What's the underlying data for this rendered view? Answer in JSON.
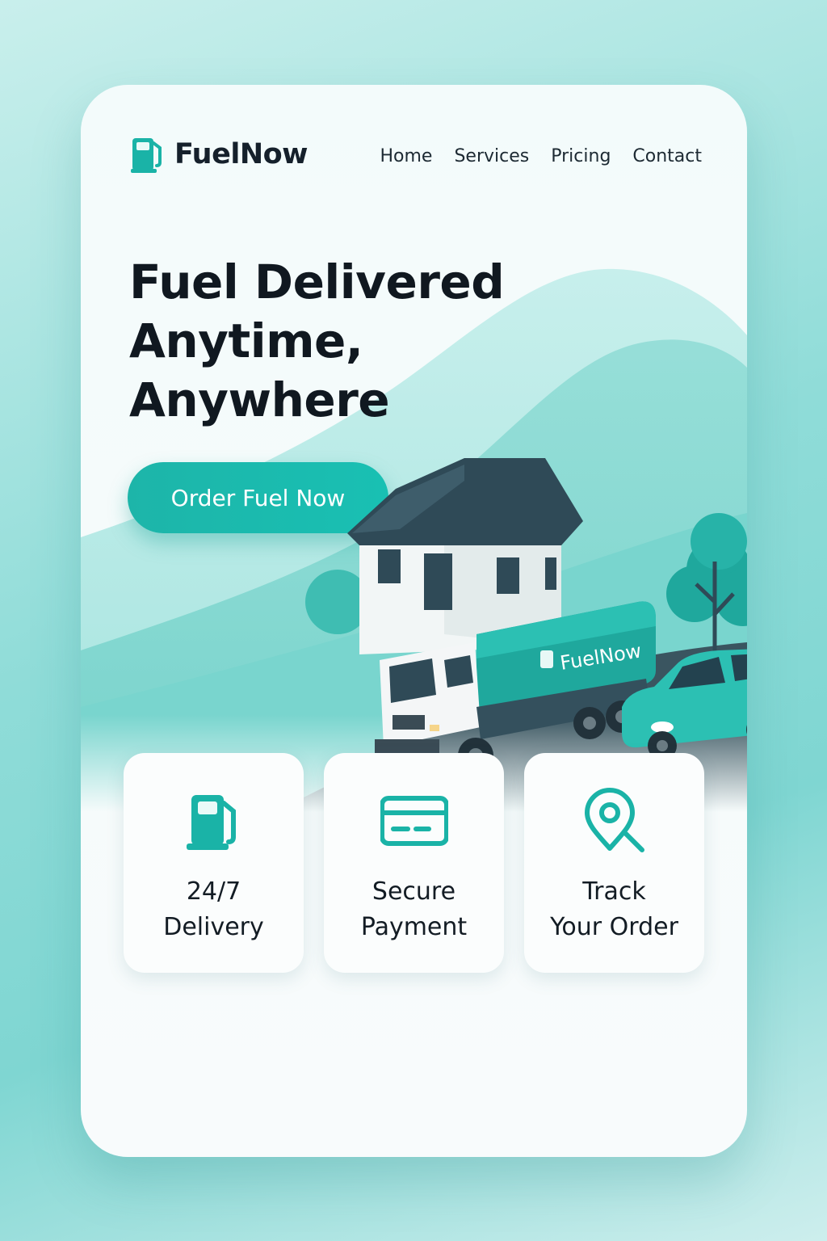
{
  "brand": {
    "name": "FuelNow",
    "icon": "fuel-pump-icon",
    "accent": "#1ab3a7"
  },
  "nav": {
    "items": [
      "Home",
      "Services",
      "Pricing",
      "Contact"
    ]
  },
  "hero": {
    "headline": [
      "Fuel Delivered",
      "Anytime,",
      "Anywhere"
    ],
    "cta_label": "Order Fuel Now",
    "truck_tank_label": "FuelNow"
  },
  "features": [
    {
      "icon": "fuel-pump-icon",
      "label": [
        "24/7",
        "Delivery"
      ]
    },
    {
      "icon": "credit-card-icon",
      "label": [
        "Secure",
        "Payment"
      ]
    },
    {
      "icon": "location-search-icon",
      "label": [
        "Track",
        "Your Order"
      ]
    }
  ]
}
